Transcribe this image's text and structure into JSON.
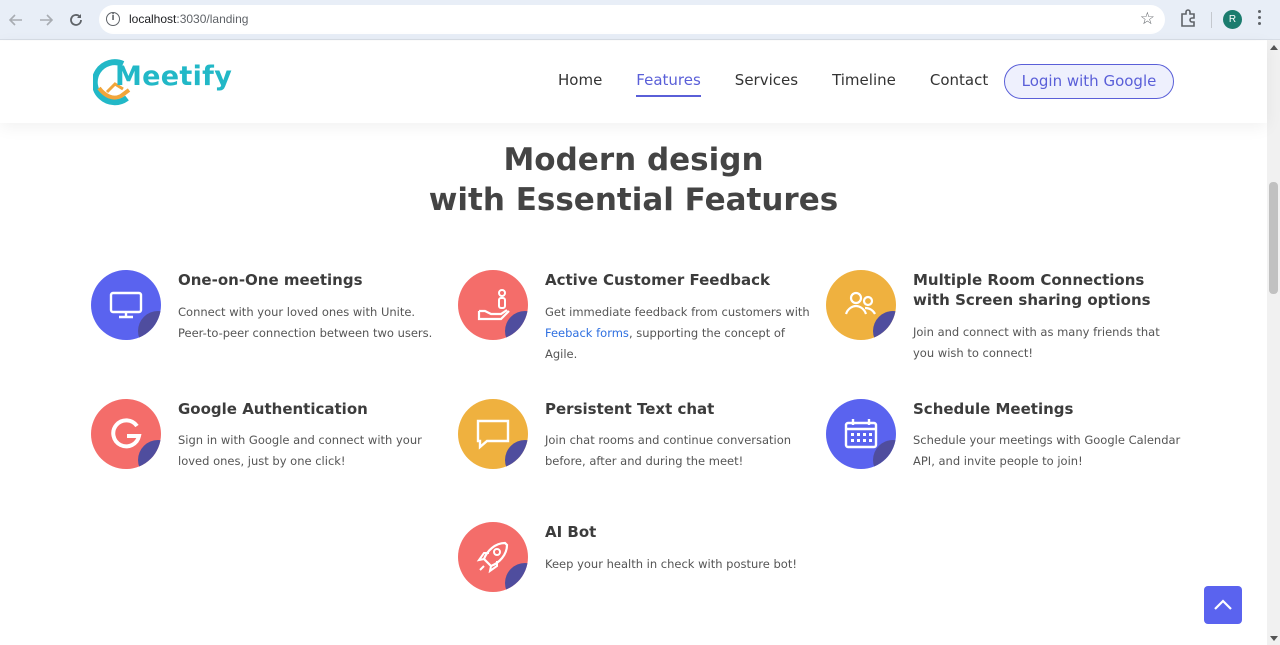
{
  "browser": {
    "url_host": "localhost",
    "url_rest": ":3030/landing",
    "profile_initial": "R"
  },
  "header": {
    "logo_text": "Meetify",
    "nav": [
      {
        "label": "Home"
      },
      {
        "label": "Features",
        "active": true
      },
      {
        "label": "Services"
      },
      {
        "label": "Timeline"
      },
      {
        "label": "Contact"
      }
    ],
    "login_label": "Login with Google"
  },
  "headline": {
    "line1": "Modern design",
    "line2": "with Essential Features"
  },
  "features": [
    {
      "title": "One-on-One meetings",
      "desc": "Connect with your loved ones with Unite. Peer-to-peer connection between two users.",
      "color": "#5a63ef",
      "icon": "monitor-icon"
    },
    {
      "title": "Active Customer Feedback",
      "desc_pre": "Get immediate feedback from customers with ",
      "desc_link": "Feeback forms",
      "desc_post": ", supporting the concept of Agile.",
      "color": "#f46d6a",
      "icon": "hand-feedback-icon"
    },
    {
      "title": "Multiple Room Connections with Screen sharing options",
      "desc": "Join and connect with as many friends that you wish to connect!",
      "color": "#efb13f",
      "icon": "users-icon"
    },
    {
      "title": "Google Authentication",
      "desc": "Sign in with Google and connect with your loved ones, just by one click!",
      "color": "#f46d6a",
      "icon": "google-g-icon"
    },
    {
      "title": "Persistent Text chat",
      "desc": "Join chat rooms and continue conversation before, after and during the meet!",
      "color": "#efb13f",
      "icon": "chat-bubble-icon"
    },
    {
      "title": "Schedule Meetings",
      "desc": "Schedule your meetings with Google Calendar API, and invite people to join!",
      "color": "#5a63ef",
      "icon": "calendar-icon"
    },
    {
      "title": "AI Bot",
      "desc": "Keep your health in check with posture bot!",
      "color": "#f46d6a",
      "icon": "rocket-icon"
    }
  ]
}
